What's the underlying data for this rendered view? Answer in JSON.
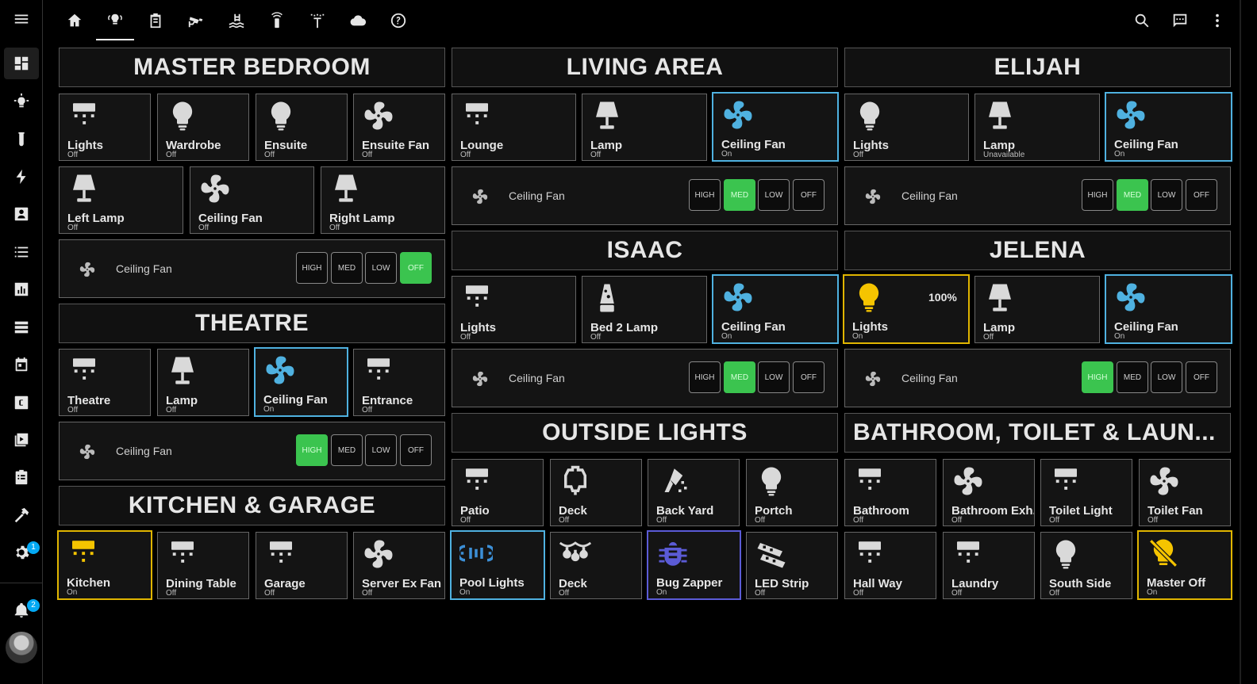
{
  "sidebar": {
    "admin_badge": "1",
    "notifications_badge": "2"
  },
  "titles": {
    "master_bedroom": "MASTER BEDROOM",
    "living_area": "LIVING AREA",
    "elijah": "ELIJAH",
    "theatre": "THEATRE",
    "isaac": "ISAAC",
    "jelena": "JELENA",
    "kitchen_garage": "KITCHEN & GARAGE",
    "outside_lights": "OUTSIDE LIGHTS",
    "bathroom": "BATHROOM, TOILET & LAUN..."
  },
  "speed_labels": {
    "high": "HIGH",
    "med": "MED",
    "low": "LOW",
    "off": "OFF"
  },
  "tiles": {
    "mb_lights": {
      "name": "Lights",
      "state": "Off"
    },
    "mb_wardrobe": {
      "name": "Wardrobe",
      "state": "Off"
    },
    "mb_ensuite": {
      "name": "Ensuite",
      "state": "Off"
    },
    "mb_ensuite_fan": {
      "name": "Ensuite Fan",
      "state": "Off"
    },
    "mb_left_lamp": {
      "name": "Left Lamp",
      "state": "Off"
    },
    "mb_ceiling_fan": {
      "name": "Ceiling Fan",
      "state": "Off"
    },
    "mb_right_lamp": {
      "name": "Right Lamp",
      "state": "Off"
    },
    "la_lounge": {
      "name": "Lounge",
      "state": "Off"
    },
    "la_lamp": {
      "name": "Lamp",
      "state": "Off"
    },
    "la_ceiling_fan": {
      "name": "Ceiling Fan",
      "state": "On"
    },
    "el_lights": {
      "name": "Lights",
      "state": "Off"
    },
    "el_lamp": {
      "name": "Lamp",
      "state": "Unavailable"
    },
    "el_ceiling_fan": {
      "name": "Ceiling Fan",
      "state": "On"
    },
    "th_theatre": {
      "name": "Theatre",
      "state": "Off"
    },
    "th_lamp": {
      "name": "Lamp",
      "state": "Off"
    },
    "th_ceiling_fan": {
      "name": "Ceiling Fan",
      "state": "On"
    },
    "th_entrance": {
      "name": "Entrance",
      "state": "Off"
    },
    "is_lights": {
      "name": "Lights",
      "state": "Off"
    },
    "is_bed2_lamp": {
      "name": "Bed 2 Lamp",
      "state": "Off"
    },
    "is_ceiling_fan": {
      "name": "Ceiling Fan",
      "state": "On"
    },
    "je_lights": {
      "name": "Lights",
      "state": "On",
      "brightness": "100%"
    },
    "je_lamp": {
      "name": "Lamp",
      "state": "Off"
    },
    "je_ceiling_fan": {
      "name": "Ceiling Fan",
      "state": "On"
    },
    "kg_kitchen": {
      "name": "Kitchen",
      "state": "On"
    },
    "kg_dining": {
      "name": "Dining Table",
      "state": "Off"
    },
    "kg_garage": {
      "name": "Garage",
      "state": "Off"
    },
    "kg_server_fan": {
      "name": "Server Ex Fan",
      "state": "Off"
    },
    "ol_patio": {
      "name": "Patio",
      "state": "Off"
    },
    "ol_deck": {
      "name": "Deck",
      "state": "Off"
    },
    "ol_back_yard": {
      "name": "Back Yard",
      "state": "Off"
    },
    "ol_portch": {
      "name": "Portch",
      "state": "Off"
    },
    "ol_pool": {
      "name": "Pool Lights",
      "state": "On"
    },
    "ol_deck2": {
      "name": "Deck",
      "state": "Off"
    },
    "ol_bug_zapper": {
      "name": "Bug Zapper",
      "state": "On"
    },
    "ol_led_strip": {
      "name": "LED Strip",
      "state": "Off"
    },
    "bt_bathroom": {
      "name": "Bathroom",
      "state": "Off"
    },
    "bt_bathroom_exh": {
      "name": "Bathroom Exh.",
      "state": "Off"
    },
    "bt_toilet_light": {
      "name": "Toilet Light",
      "state": "Off"
    },
    "bt_toilet_fan": {
      "name": "Toilet Fan",
      "state": "Off"
    },
    "bt_hall_way": {
      "name": "Hall Way",
      "state": "Off"
    },
    "bt_laundry": {
      "name": "Laundry",
      "state": "Off"
    },
    "bt_south_side": {
      "name": "South Side",
      "state": "Off"
    },
    "bt_master_off": {
      "name": "Master Off",
      "state": "On"
    }
  },
  "fan_rows": {
    "master_bedroom": {
      "label": "Ceiling Fan",
      "speed": "OFF"
    },
    "living_area": {
      "label": "Ceiling Fan",
      "speed": "MED"
    },
    "elijah": {
      "label": "Ceiling Fan",
      "speed": "MED"
    },
    "theatre": {
      "label": "Ceiling Fan",
      "speed": "HIGH"
    },
    "isaac": {
      "label": "Ceiling Fan",
      "speed": "MED"
    },
    "jelena": {
      "label": "Ceiling Fan",
      "speed": "HIGH"
    }
  },
  "colors": {
    "on_blue": "#4fb1e0",
    "on_yellow": "#f5c400",
    "on_purple": "#5b5bd6",
    "icon_off": "#d9d9d9",
    "speed_selected": "#3bc44f"
  }
}
